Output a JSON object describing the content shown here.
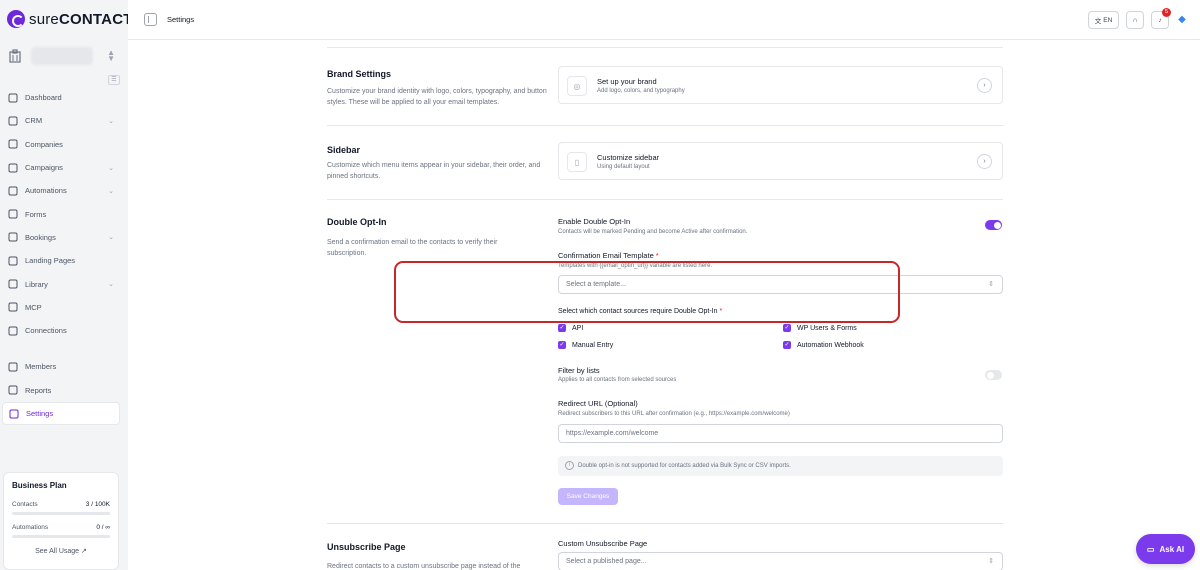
{
  "brand": {
    "logo_text_light": "sure",
    "logo_text_bold": "CONTACT"
  },
  "sidebar": {
    "items": [
      {
        "label": "Dashboard",
        "icon": "dashboard-icon",
        "caret": false
      },
      {
        "label": "CRM",
        "icon": "crm-icon",
        "caret": true
      },
      {
        "label": "Companies",
        "icon": "building-icon",
        "caret": false
      },
      {
        "label": "Campaigns",
        "icon": "megaphone-icon",
        "caret": true
      },
      {
        "label": "Automations",
        "icon": "flow-icon",
        "caret": true
      },
      {
        "label": "Forms",
        "icon": "form-icon",
        "caret": false
      },
      {
        "label": "Bookings",
        "icon": "calendar-icon",
        "caret": true
      },
      {
        "label": "Landing Pages",
        "icon": "layout-icon",
        "caret": false
      },
      {
        "label": "Library",
        "icon": "library-icon",
        "caret": true
      },
      {
        "label": "MCP",
        "icon": "mcp-icon",
        "caret": false
      },
      {
        "label": "Connections",
        "icon": "plug-icon",
        "caret": false
      }
    ],
    "items2": [
      {
        "label": "Members",
        "icon": "users-icon"
      },
      {
        "label": "Reports",
        "icon": "chart-icon"
      },
      {
        "label": "Settings",
        "icon": "gear-icon",
        "active": true
      }
    ],
    "plan": {
      "title": "Business Plan",
      "contacts_label": "Contacts",
      "contacts_value": "3 / 100K",
      "automations_label": "Automations",
      "automations_value": "0 / ∞",
      "link": "See All Usage ↗"
    }
  },
  "topbar": {
    "title": "Settings",
    "lang": "EN",
    "notifications": "5"
  },
  "brand_settings": {
    "title": "Brand Settings",
    "desc": "Customize your brand identity with logo, colors, typography, and button styles. These will be applied to all your email templates.",
    "card_title": "Set up your brand",
    "card_sub": "Add logo, colors, and typography"
  },
  "sidebar_settings": {
    "title": "Sidebar",
    "desc": "Customize which menu items appear in your sidebar, their order, and pinned shortcuts.",
    "card_title": "Customize sidebar",
    "card_sub": "Using default layout"
  },
  "double_optin": {
    "title": "Double Opt-In",
    "desc": "Send a confirmation email to the contacts to verify their subscription.",
    "enable_label": "Enable Double Opt-In",
    "enable_help": "Contacts will be marked Pending and become Active after confirmation.",
    "enabled": true,
    "template_label": "Confirmation Email Template",
    "template_help": "Templates with {{email_optin_url}} variable are listed here.",
    "template_placeholder": "Select a template...",
    "sources_label": "Select which contact sources require Double Opt-In",
    "sources": [
      "API",
      "WP Users & Forms",
      "Manual Entry",
      "Automation Webhook"
    ],
    "filter_label": "Filter by lists",
    "filter_help": "Applies to all contacts from selected sources",
    "filter_enabled": false,
    "redirect_label": "Redirect URL (Optional)",
    "redirect_help": "Redirect subscribers to this URL after confirmation (e.g., https://example.com/welcome)",
    "redirect_placeholder": "https://example.com/welcome",
    "notice": "Double opt-in is not supported for contacts added via Bulk Sync or CSV imports.",
    "save_label": "Save Changes"
  },
  "unsubscribe": {
    "title": "Unsubscribe Page",
    "desc": "Redirect contacts to a custom unsubscribe page instead of the",
    "page_label": "Custom Unsubscribe Page",
    "page_placeholder": "Select a published page..."
  },
  "ask_ai": "Ask AI",
  "colors": {
    "accent": "#7c3aed",
    "highlight": "#c62828"
  }
}
